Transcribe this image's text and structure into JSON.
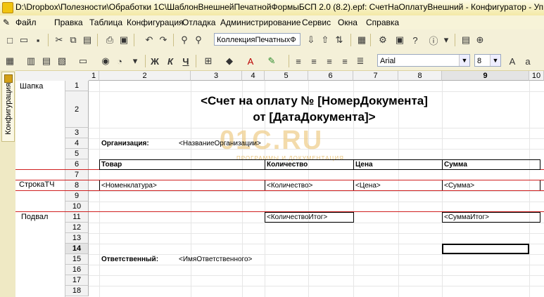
{
  "window": {
    "title": "D:\\Dropbox\\Полезности\\Обработки 1С\\ШаблонВнешнейПечатнойФормыБСП 2.0 (8.2).epf: СчетНаОплатуВнешний - Конфигуратор - Уп"
  },
  "menu": [
    "Файл",
    "Правка",
    "Таблица",
    "Конфигурация",
    "Отладка",
    "Администрирование",
    "Сервис",
    "Окна",
    "Справка"
  ],
  "toolbar": {
    "collection_combo": "КоллекцияПечатныхФ",
    "font_combo": "Arial",
    "size_combo": "8",
    "bold": "Ж",
    "italic": "К",
    "underline": "Ч"
  },
  "side_tab": {
    "label": "Конфигурация"
  },
  "sheet": {
    "columns": [
      "1",
      "2",
      "3",
      "4",
      "5",
      "6",
      "7",
      "8",
      "9",
      "10"
    ],
    "rows": [
      "1",
      "2",
      "3",
      "4",
      "5",
      "6",
      "7",
      "8",
      "9",
      "10",
      "11",
      "12",
      "13",
      "14",
      "15",
      "16",
      "17",
      "18"
    ],
    "groups": {
      "header": "Шапка",
      "row": "СтрокаТЧ",
      "footer": "Подвал"
    },
    "title_line1": "<Счет на оплату № [НомерДокумента]",
    "title_line2": "от [ДатаДокумента]>",
    "org_label": "Организация:",
    "org_value": "<НазваниеОрганизации>",
    "col_goods": "Товар",
    "col_qty": "Количество",
    "col_price": "Цена",
    "col_sum": "Сумма",
    "row_goods": "<Номенклатура>",
    "row_qty": "<Количество>",
    "row_price": "<Цена>",
    "row_sum": "<Сумма>",
    "total_qty": "<КоличествоИтог>",
    "total_sum": "<СуммаИтог>",
    "resp_label": "Ответственный:",
    "resp_value": "<ИмяОтветственного>",
    "watermark": "01C.RU",
    "watermark_sub": "ПРОГРАММЫ И ДОКУМЕНТАЦИЯ"
  },
  "colors": {
    "grid_border": "#000000",
    "group_line": "#d02020",
    "watermark": "#e8c37a"
  }
}
